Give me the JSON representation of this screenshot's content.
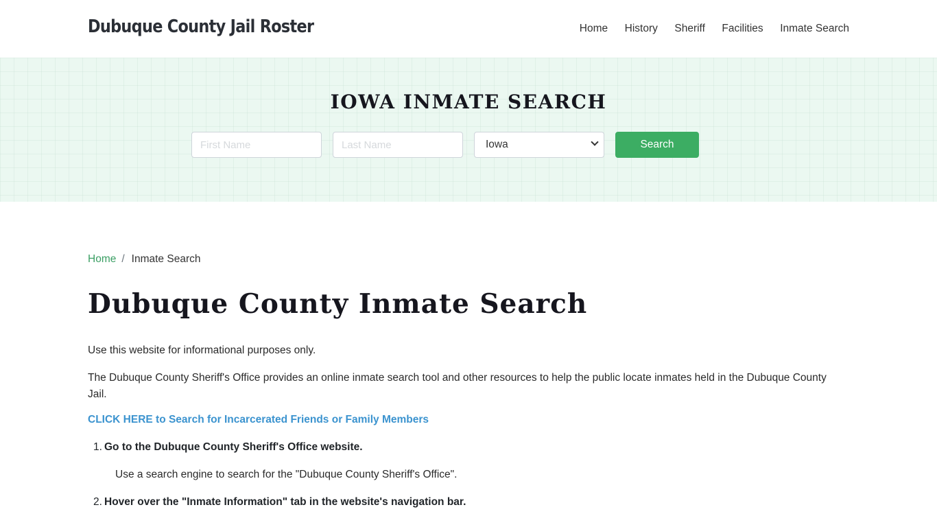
{
  "header": {
    "brand": "Dubuque County Jail Roster",
    "nav": [
      {
        "label": "Home"
      },
      {
        "label": "History"
      },
      {
        "label": "Sheriff"
      },
      {
        "label": "Facilities"
      },
      {
        "label": "Inmate Search"
      }
    ]
  },
  "hero": {
    "title": "IOWA INMATE SEARCH",
    "first_name_placeholder": "First Name",
    "last_name_placeholder": "Last Name",
    "state_selected": "Iowa",
    "search_label": "Search",
    "accent_color": "#3cad63"
  },
  "breadcrumb": {
    "home": "Home",
    "separator": "/",
    "current": "Inmate Search"
  },
  "main": {
    "title": "Dubuque County Inmate Search",
    "paragraphs": [
      "Use this website for informational purposes only.",
      "The Dubuque County Sheriff's Office provides an online inmate search tool and other resources to help the public locate inmates held in the Dubuque County Jail."
    ],
    "cta_link": "CLICK HERE to Search for Incarcerated Friends or Family Members",
    "steps": [
      {
        "number": "1.",
        "title": "Go to the Dubuque County Sheriff's Office website.",
        "description": "Use a search engine to search for the \"Dubuque County Sheriff's Office\"."
      },
      {
        "number": "2.",
        "title": "Hover over the \"Inmate Information\" tab in the website's navigation bar."
      }
    ]
  }
}
